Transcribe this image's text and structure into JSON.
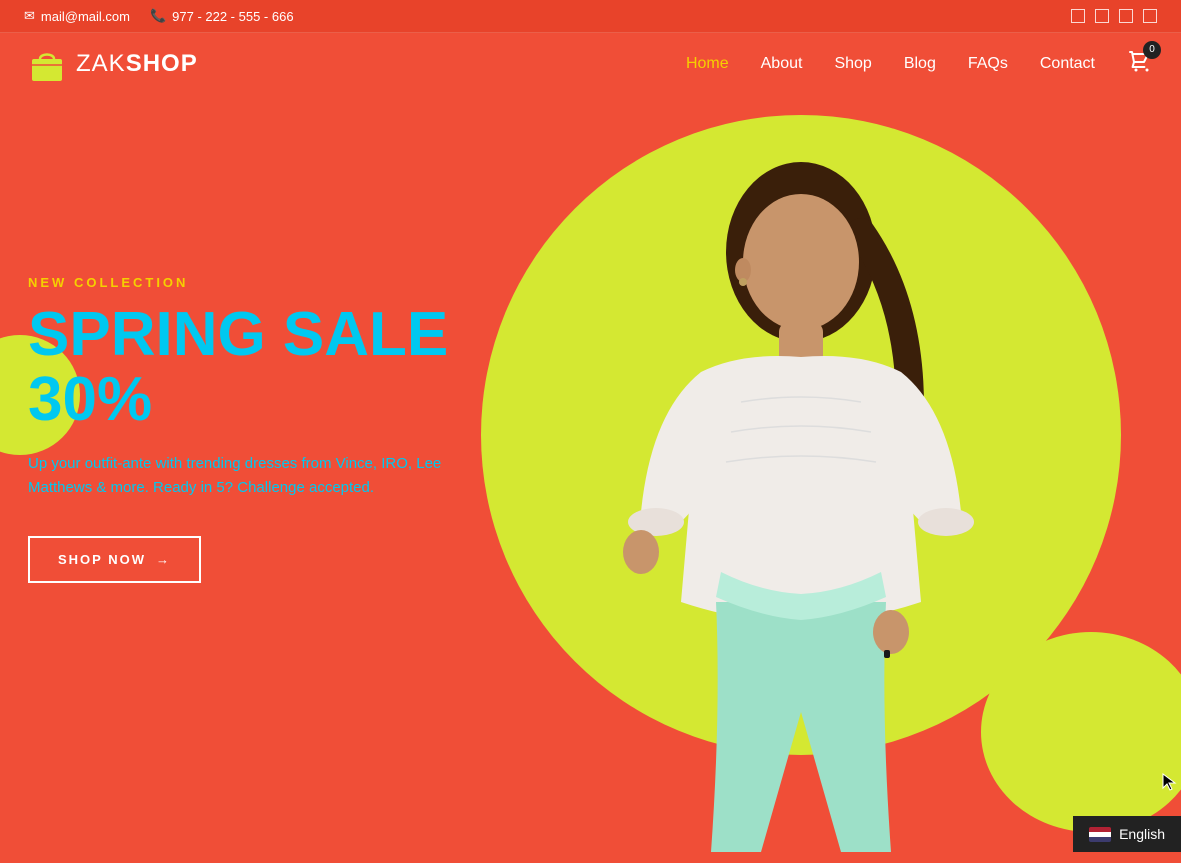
{
  "topbar": {
    "email": "mail@mail.com",
    "phone": "977 - 222 - 555 - 666",
    "email_icon": "envelope",
    "phone_icon": "phone"
  },
  "navbar": {
    "logo_text_zak": "ZAK",
    "logo_text_shop": "SHOP",
    "nav_items": [
      {
        "label": "Home",
        "active": true
      },
      {
        "label": "About",
        "active": false
      },
      {
        "label": "Shop",
        "active": false
      },
      {
        "label": "Blog",
        "active": false
      },
      {
        "label": "FAQs",
        "active": false
      },
      {
        "label": "Contact",
        "active": false
      }
    ],
    "cart_count": "0"
  },
  "hero": {
    "label": "NEW COLLECTION",
    "title": "SPRING SALE 30%",
    "description": "Up your outfit-ante with trending dresses from Vince, IRO, Lee Matthews & more. Ready in 5? Challenge accepted.",
    "cta_label": "SHOP NOW"
  },
  "language": {
    "flag_label": "en_US",
    "name": "English"
  },
  "colors": {
    "primary_bg": "#f04e37",
    "accent_yellow": "#d4e832",
    "text_cyan": "#00c8f0",
    "nav_active": "#f5d000",
    "dark": "#222222"
  }
}
